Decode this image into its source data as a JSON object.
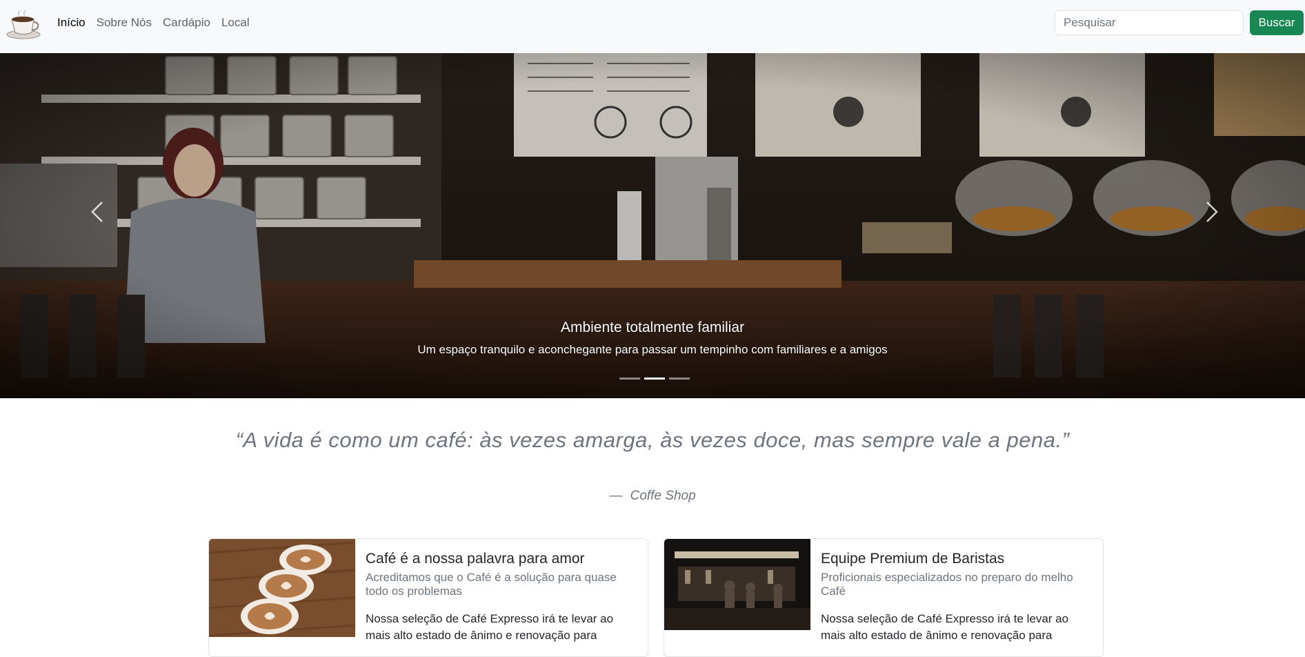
{
  "navbar": {
    "logo_icon": "coffee-cup-icon",
    "links": [
      {
        "label": "Início",
        "active": true
      },
      {
        "label": "Sobre Nós",
        "active": false
      },
      {
        "label": "Cardápio",
        "active": false
      },
      {
        "label": "Local",
        "active": false
      }
    ],
    "search": {
      "placeholder": "Pesquisar",
      "button_label": "Buscar"
    }
  },
  "carousel": {
    "caption_title": "Ambiente totalmente familiar",
    "caption_text": "Um espaço tranquilo e aconchegante para passar um tempinho com familiares e a amigos",
    "slide_count": 3,
    "active_slide": 2,
    "prev_icon": "chevron-left-icon",
    "next_icon": "chevron-right-icon"
  },
  "quote": {
    "text": "“A vida é como um café: às vezes amarga, às vezes doce, mas sempre vale a pena.”",
    "dash": "—",
    "source": "Coffe Shop"
  },
  "cards": [
    {
      "title": "Café é a nossa palavra para amor",
      "subtitle": "Acreditamos que o Café é a solução para quase todo os problemas",
      "text": "Nossa seleção de Café Expresso irá te levar ao mais alto estado de ânimo e renovação para"
    },
    {
      "title": "Equipe Premium de Baristas",
      "subtitle": "Proficionais especializados no preparo do melho Café",
      "text": "Nossa seleção de Café Expresso irá te levar ao mais alto estado de ânimo e renovação para"
    }
  ],
  "colors": {
    "accent": "#198754",
    "navbar_bg": "#f8f9fa",
    "muted_text": "#6c757d"
  }
}
